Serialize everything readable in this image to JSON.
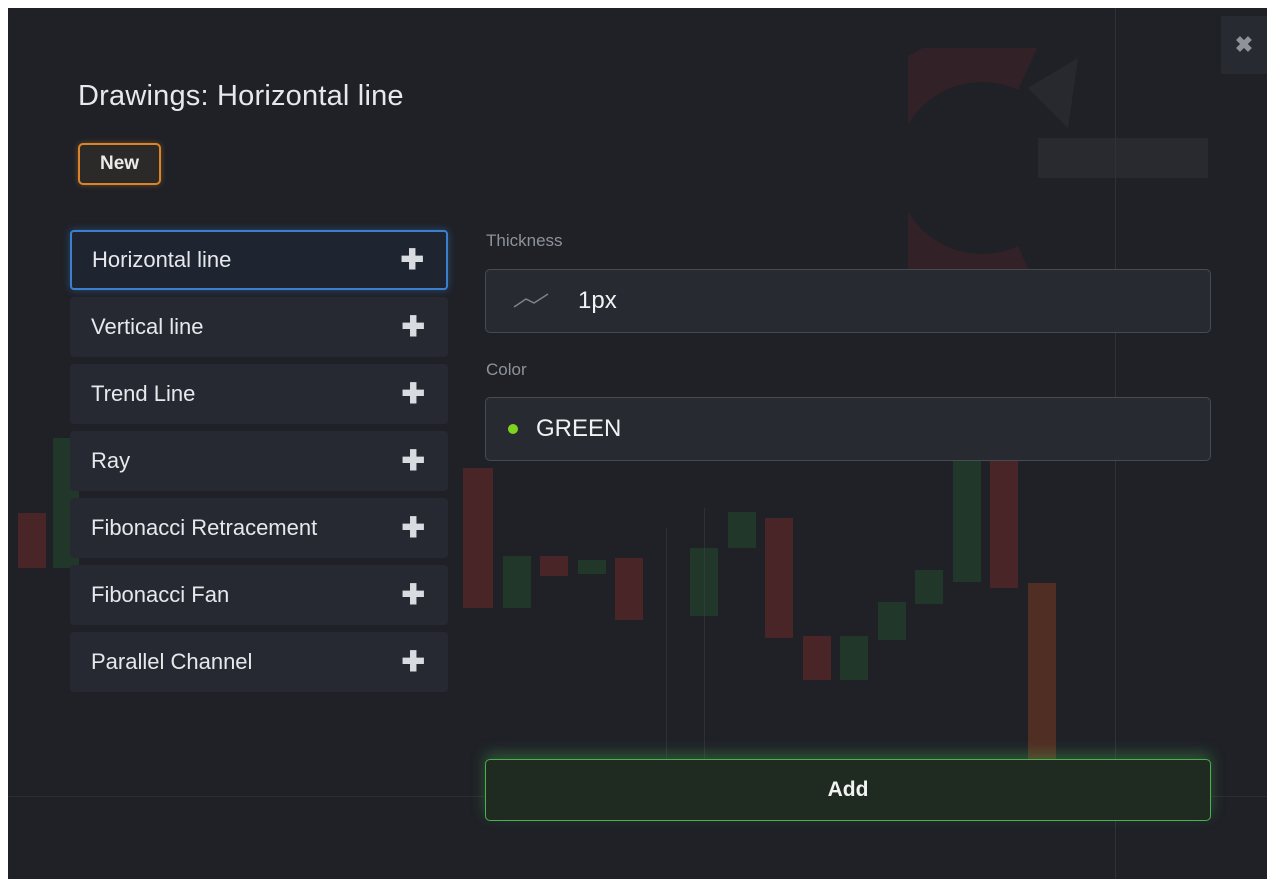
{
  "dialog": {
    "title": "Drawings: Horizontal line",
    "new_badge": "New",
    "close_icon": "close-icon"
  },
  "tools": [
    {
      "label": "Horizontal line",
      "active": true
    },
    {
      "label": "Vertical line",
      "active": false
    },
    {
      "label": "Trend Line",
      "active": false
    },
    {
      "label": "Ray",
      "active": false
    },
    {
      "label": "Fibonacci Retracement",
      "active": false
    },
    {
      "label": "Fibonacci Fan",
      "active": false
    },
    {
      "label": "Parallel Channel",
      "active": false
    }
  ],
  "thickness": {
    "label": "Thickness",
    "value": "1px",
    "icon": "line-thickness-icon"
  },
  "color": {
    "label": "Color",
    "value": "GREEN",
    "swatch": "#7ed321"
  },
  "actions": {
    "add_label": "Add"
  },
  "colors": {
    "background": "#1f2127",
    "active_border": "#3b7fd0",
    "badge_border": "#d9842a",
    "add_border": "#4caf50"
  }
}
